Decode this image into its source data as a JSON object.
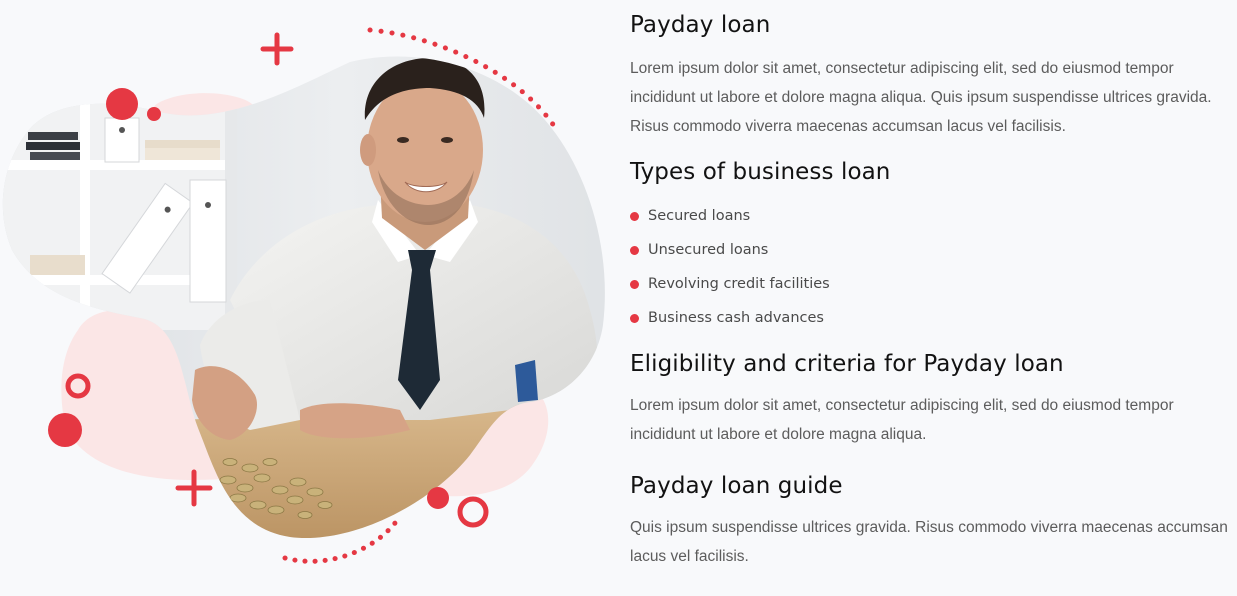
{
  "colors": {
    "accent": "#e53843",
    "accent_light": "#fbe6e6",
    "heading": "#121212",
    "body_text": "#5c5c5c",
    "background": "#f8f9fb"
  },
  "image": {
    "icon": "businessman-handshake-photo"
  },
  "sections": [
    {
      "heading": "Payday loan",
      "text": "Lorem ipsum dolor sit amet, consectetur adipiscing elit, sed do eiusmod tempor incididunt ut labore et dolore magna aliqua. Quis ipsum suspendisse ultrices gravida. Risus commodo viverra maecenas accumsan lacus vel facilisis."
    },
    {
      "heading": "Types of business loan",
      "items": [
        "Secured loans",
        "Unsecured loans",
        "Revolving credit facilities",
        "Business cash advances"
      ]
    },
    {
      "heading": "Eligibility and criteria for Payday loan",
      "text": "Lorem ipsum dolor sit amet, consectetur adipiscing elit, sed do eiusmod tempor incididunt ut labore et dolore magna aliqua."
    },
    {
      "heading": "Payday loan guide",
      "text": "Quis ipsum suspendisse ultrices gravida. Risus commodo viverra maecenas accumsan lacus vel facilisis."
    }
  ]
}
